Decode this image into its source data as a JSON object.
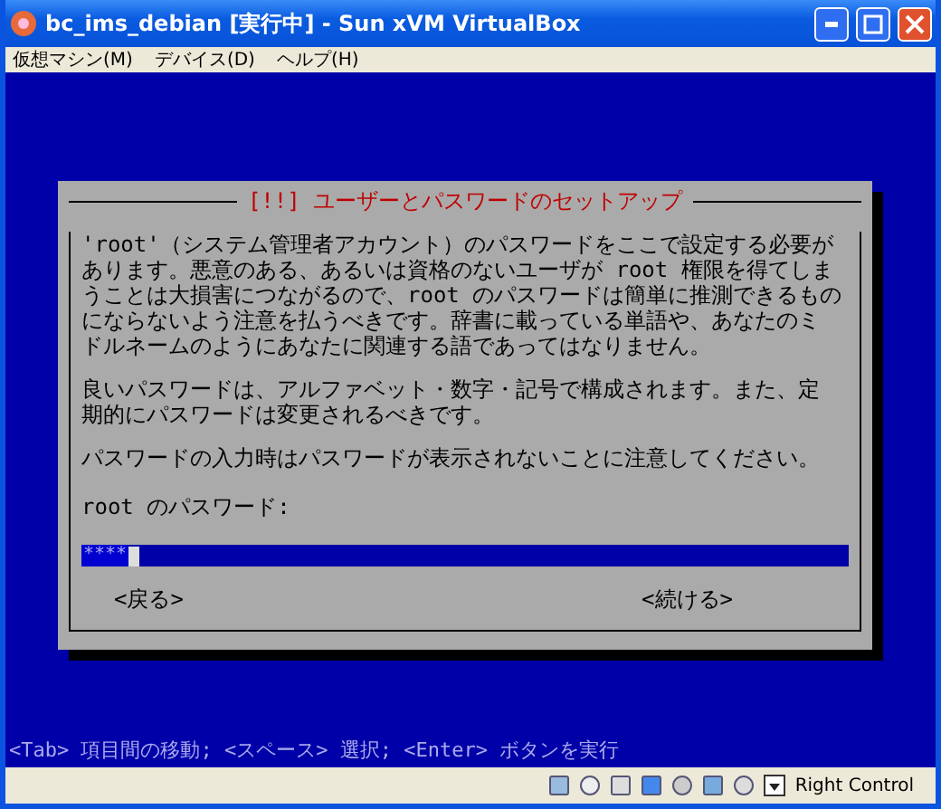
{
  "window": {
    "title": "bc_ims_debian [実行中] - Sun xVM VirtualBox"
  },
  "menu": [
    "仮想マシン(M)",
    "デバイス(D)",
    "ヘルプ(H)"
  ],
  "dialog": {
    "title": "[!!] ユーザーとパスワードのセットアップ",
    "paragraphs": [
      [
        "'root'（システム管理者アカウント）のパスワードをここで設定する必要が",
        "あります。悪意のある、あるいは資格のないユーザが root 権限を得てしま",
        "うことは大損害につながるので、root のパスワードは簡単に推測できるもの",
        "にならないよう注意を払うべきです。辞書に載っている単語や、あなたのミ",
        "ドルネームのようにあなたに関連する語であってはなりません。"
      ],
      [
        "良いパスワードは、アルファベット・数字・記号で構成されます。また、定",
        "期的にパスワードは変更されるべきです。"
      ],
      [
        "パスワードの入力時はパスワードが表示されないことに注意してください。"
      ]
    ],
    "field_label": "root のパスワード:",
    "field_value": "****",
    "buttons": [
      "<戻る>",
      "<続ける>"
    ]
  },
  "help_line": "<Tab> 項目間の移動; <スペース> 選択; <Enter> ボタンを実行",
  "status_bar": {
    "host_key": "Right Control"
  }
}
